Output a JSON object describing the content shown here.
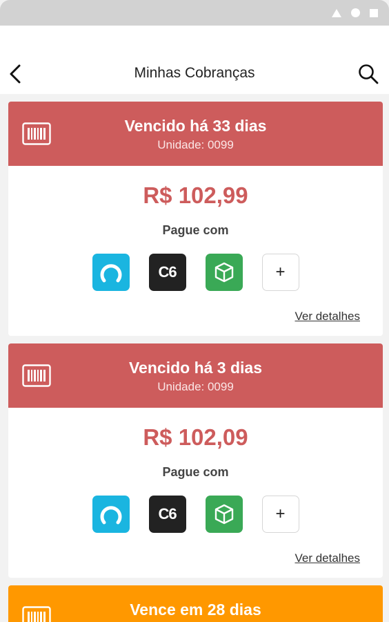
{
  "header": {
    "title": "Minhas Cobranças"
  },
  "icons": {
    "back": "chevron-left-icon",
    "search": "search-icon",
    "barcode": "barcode-icon"
  },
  "colors": {
    "overdue": "#cd5c5c",
    "upcoming": "#ff9800",
    "accent": "#cd5c5c"
  },
  "cards": [
    {
      "status": "Vencido há 33 dias",
      "unit": "Unidade: 0099",
      "amount": "R$ 102,99",
      "pay_label": "Pague com",
      "pay_methods": [
        "app-a",
        "C6",
        "app-green",
        "+"
      ],
      "details_label": "Ver detalhes"
    },
    {
      "status": "Vencido há 3 dias",
      "unit": "Unidade: 0099",
      "amount": "R$ 102,09",
      "pay_label": "Pague com",
      "pay_methods": [
        "app-a",
        "C6",
        "app-green",
        "+"
      ],
      "details_label": "Ver detalhes"
    },
    {
      "status": "Vence em 28 dias"
    }
  ],
  "pay": {
    "c6_label": "C6",
    "more_label": "+"
  }
}
